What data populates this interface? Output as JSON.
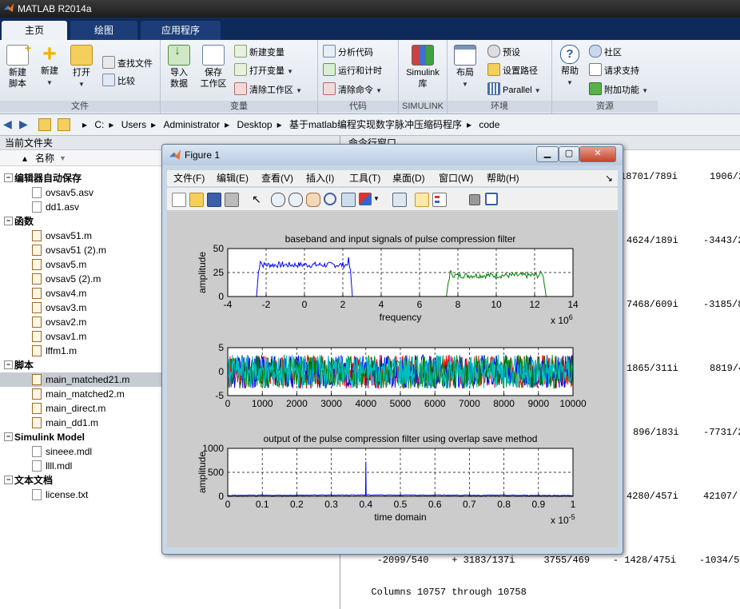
{
  "app": {
    "title": "MATLAB R2014a"
  },
  "ribbon_tabs": [
    {
      "label": "主页"
    },
    {
      "label": "绘图"
    },
    {
      "label": "应用程序"
    }
  ],
  "ribbon": {
    "file": {
      "label": "文件",
      "new_script": "新建\n脚本",
      "new": "新建",
      "open": "打开",
      "find_files": "查找文件",
      "compare": "比较"
    },
    "variable": {
      "label": "变量",
      "import": "导入\n数据",
      "save_ws": "保存\n工作区",
      "new_var": "新建变量",
      "open_var": "打开变量",
      "clear_ws": "清除工作区"
    },
    "code": {
      "label": "代码",
      "analyze": "分析代码",
      "run_time": "运行和计时",
      "clear_cmd": "清除命令"
    },
    "simulink": {
      "label": "SIMULINK",
      "lib": "Simulink\n库"
    },
    "env": {
      "label": "环境",
      "layout": "布局",
      "prefs": "预设",
      "set_path": "设置路径",
      "parallel": "Parallel"
    },
    "resources": {
      "label": "资源",
      "help": "帮助",
      "community": "社区",
      "support": "请求支持",
      "addons": "附加功能"
    }
  },
  "address": {
    "crumbs": [
      "C:",
      "Users",
      "Administrator",
      "Desktop",
      "基于matlab编程实现数字脉冲压缩码程序",
      "code"
    ]
  },
  "left_panel": {
    "title": "当前文件夹",
    "col_name": "名称",
    "rows": [
      {
        "text": "编辑器自动保存",
        "kind": "cat"
      },
      {
        "text": "ovsav5.asv",
        "kind": "file"
      },
      {
        "text": "dd1.asv",
        "kind": "file"
      },
      {
        "text": "函数",
        "kind": "cat"
      },
      {
        "text": "ovsav51.m",
        "kind": "m"
      },
      {
        "text": "ovsav51 (2).m",
        "kind": "m"
      },
      {
        "text": "ovsav5.m",
        "kind": "m"
      },
      {
        "text": "ovsav5 (2).m",
        "kind": "m"
      },
      {
        "text": "ovsav4.m",
        "kind": "m"
      },
      {
        "text": "ovsav3.m",
        "kind": "m"
      },
      {
        "text": "ovsav2.m",
        "kind": "m"
      },
      {
        "text": "ovsav1.m",
        "kind": "m"
      },
      {
        "text": "lffm1.m",
        "kind": "m"
      },
      {
        "text": "脚本",
        "kind": "cat"
      },
      {
        "text": "main_matched21.m",
        "kind": "m",
        "selected": true
      },
      {
        "text": "main_matched2.m",
        "kind": "m"
      },
      {
        "text": "main_direct.m",
        "kind": "m"
      },
      {
        "text": "main_dd1.m",
        "kind": "m"
      },
      {
        "text": "Simulink Model",
        "kind": "cat"
      },
      {
        "text": "sineee.mdl",
        "kind": "mdl"
      },
      {
        "text": "llll.mdl",
        "kind": "mdl"
      },
      {
        "text": "文本文档",
        "kind": "cat"
      },
      {
        "text": "license.txt",
        "kind": "file"
      }
    ]
  },
  "command_window": {
    "title": "命令行窗口",
    "lines": [
      {
        "c1": "18701/789i",
        "c2": "1906/2"
      },
      {
        "c1": "4624/189i",
        "c2": "-3443/2"
      },
      {
        "c1": "7468/609i",
        "c2": "-3185/8"
      },
      {
        "c1": "1865/311i",
        "c2": "8819/4"
      },
      {
        "c1": "896/183i",
        "c2": "-7731/2"
      },
      {
        "c1": "4280/457i",
        "c2": "42107/"
      }
    ],
    "last_row": "   -2099/540    + 3183/137i     3755/469    - 1428/475i    -1034/5",
    "columns_line": "  Columns 10757 through 10758"
  },
  "figure": {
    "title": "Figure 1",
    "menu": [
      "文件(F)",
      "编辑(E)",
      "查看(V)",
      "插入(I)",
      "工具(T)",
      "桌面(D)",
      "窗口(W)",
      "帮助(H)"
    ],
    "menu_arrow": "↘"
  },
  "chart_data": [
    {
      "type": "line",
      "title": "baseband and input signals of pulse compression filter",
      "xlabel": "frequency",
      "ylabel": "amplitude",
      "x_multiplier": "x 10^6",
      "xlim": [
        -4,
        14
      ],
      "ylim": [
        0,
        50
      ],
      "xticks": [
        "-4",
        "-2",
        "0",
        "2",
        "4",
        "6",
        "8",
        "10",
        "12",
        "14"
      ],
      "yticks": [
        "0",
        "25",
        "50"
      ],
      "grid": true,
      "series": [
        {
          "color": "#0000ff",
          "x": [
            -2.5,
            -2.4,
            -2.3,
            -2.2,
            0,
            2.2,
            2.3,
            2.4,
            2.5
          ],
          "y": [
            0,
            25,
            38,
            33,
            33,
            33,
            38,
            25,
            0
          ]
        },
        {
          "color": "#008000",
          "x": [
            7.4,
            7.5,
            7.6,
            7.8,
            10,
            12.2,
            12.4,
            12.5,
            12.6
          ],
          "y": [
            0,
            15,
            25,
            22,
            22,
            22,
            25,
            15,
            0
          ]
        }
      ]
    },
    {
      "type": "line",
      "title": "",
      "xlabel": "",
      "ylabel": "",
      "xlim": [
        0,
        10000
      ],
      "ylim": [
        -5,
        5
      ],
      "xticks": [
        "0",
        "1000",
        "2000",
        "3000",
        "4000",
        "5000",
        "6000",
        "7000",
        "8000",
        "9000",
        "10000"
      ],
      "yticks": [
        "-5",
        "0",
        "5"
      ],
      "grid": true,
      "series": [
        {
          "color": "#ff0000",
          "x": [
            0,
            10000
          ],
          "y": [
            0,
            0
          ],
          "noise_amplitude": 3.5
        },
        {
          "color": "#0000ff",
          "x": [
            0,
            10000
          ],
          "y": [
            0,
            0
          ],
          "noise_amplitude": 3.5
        },
        {
          "color": "#008000",
          "x": [
            0,
            10000
          ],
          "y": [
            0,
            0
          ],
          "noise_amplitude": 3.5
        },
        {
          "color": "#00bfbf",
          "x": [
            0,
            10000
          ],
          "y": [
            0,
            0
          ],
          "noise_amplitude": 3.5
        }
      ]
    },
    {
      "type": "line",
      "title": "output of the pulse compression filter using overlap save method",
      "xlabel": "time domain",
      "ylabel": "amplitude",
      "x_multiplier": "x 10^-5",
      "xlim": [
        0,
        1
      ],
      "ylim": [
        0,
        1000
      ],
      "xticks": [
        "0",
        "0.1",
        "0.2",
        "0.3",
        "0.4",
        "0.5",
        "0.6",
        "0.7",
        "0.8",
        "0.9",
        "1"
      ],
      "yticks": [
        "0",
        "500",
        "1000"
      ],
      "grid": true,
      "series": [
        {
          "color": "#0000ff",
          "x": [
            0,
            0.399,
            0.4,
            0.401,
            1
          ],
          "y": [
            10,
            20,
            720,
            20,
            10
          ]
        }
      ]
    }
  ]
}
